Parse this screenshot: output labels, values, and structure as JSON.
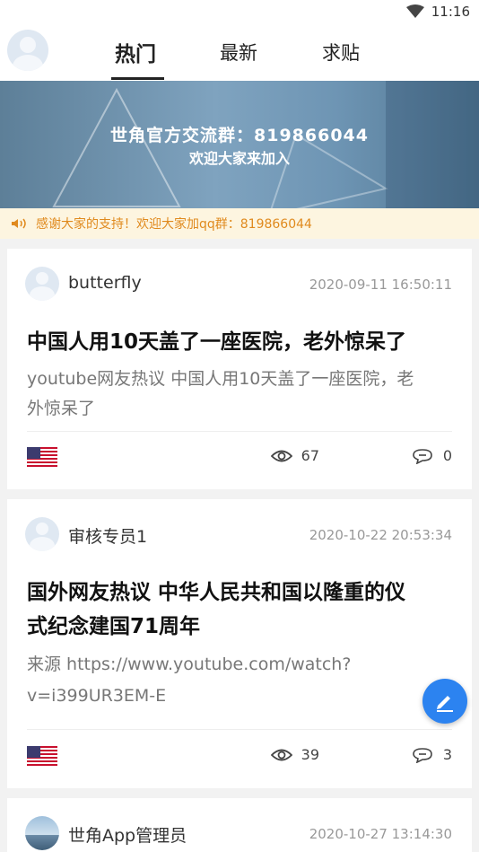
{
  "status": {
    "time": "11:16"
  },
  "tabs": [
    {
      "label": "热门"
    },
    {
      "label": "最新"
    },
    {
      "label": "求贴"
    }
  ],
  "banner": {
    "line1": "世角官方交流群：819866044",
    "line2": "欢迎大家来加入"
  },
  "notice": {
    "text": "感谢大家的支持！欢迎大家加qq群：819866044"
  },
  "posts": [
    {
      "author": "butterfly",
      "time": "2020-09-11 16:50:11",
      "title": "中国人用10天盖了一座医院，老外惊呆了",
      "excerpt_lines": [
        "youtube网友热议 中国人用10天盖了一座医院，老",
        "外惊呆了"
      ],
      "views": "67",
      "comments": "0",
      "flag_icon": "us-flag-icon"
    },
    {
      "author": "审核专员1",
      "time": "2020-10-22 20:53:34",
      "title_lines": [
        "国外网友热议 中华人民共和国以隆重的仪",
        "式纪念建国71周年"
      ],
      "excerpt_lines": [
        "来源 https://www.youtube.com/watch?",
        "v=i399UR3EM-E"
      ],
      "views": "39",
      "comments": "3",
      "flag_icon": "us-flag-icon"
    },
    {
      "author": "世角App管理员",
      "time": "2020-10-27 13:14:30"
    }
  ],
  "colors": {
    "accent": "#2c83f0",
    "notice_text": "#e08a1e",
    "notice_bg": "#fdf5e0"
  }
}
